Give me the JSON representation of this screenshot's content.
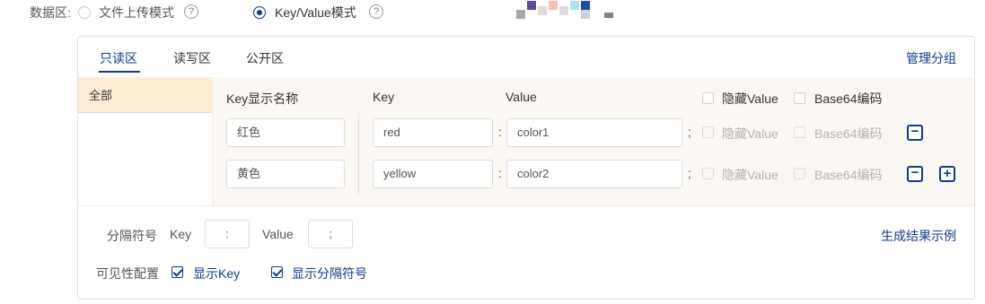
{
  "mode": {
    "label": "数据区:",
    "options": [
      {
        "label": "文件上传模式",
        "selected": false
      },
      {
        "label": "Key/Value模式",
        "selected": true
      }
    ],
    "help_glyph": "?"
  },
  "tabs": [
    {
      "label": "只读区",
      "active": true
    },
    {
      "label": "读写区",
      "active": false
    },
    {
      "label": "公开区",
      "active": false
    }
  ],
  "manage_link": "管理分组",
  "groups": [
    {
      "label": "全部",
      "selected": true
    }
  ],
  "columns": {
    "display_name": "Key显示名称",
    "key": "Key",
    "value": "Value",
    "hide_value": "隐藏Value",
    "base64": "Base64编码"
  },
  "rows": [
    {
      "display_name": "红色",
      "key": "red",
      "value": "color1",
      "key_sep": ":",
      "value_sep": ";",
      "hide_value": "隐藏Value",
      "base64": "Base64编码"
    },
    {
      "display_name": "黄色",
      "key": "yellow",
      "value": "color2",
      "key_sep": ":",
      "value_sep": ";",
      "hide_value": "隐藏Value",
      "base64": "Base64编码"
    }
  ],
  "row_icons": {
    "remove": "−",
    "add": "+"
  },
  "separator": {
    "label": "分隔符号",
    "key_label": "Key",
    "key_value": ":",
    "value_label": "Value",
    "value_value": ";"
  },
  "example_link": "生成结果示例",
  "visibility": {
    "label": "可见性配置",
    "show_key": {
      "label": "显示Key",
      "checked": true
    },
    "show_separator": {
      "label": "显示分隔符号",
      "checked": true
    }
  },
  "colors": {
    "accent": "#0d3b8f",
    "selected_group_bg": "#fcecd4",
    "table_bg": "#fbf8f3"
  },
  "icons": [
    "help-icon",
    "minus-square-icon",
    "plus-square-icon",
    "check-icon"
  ]
}
